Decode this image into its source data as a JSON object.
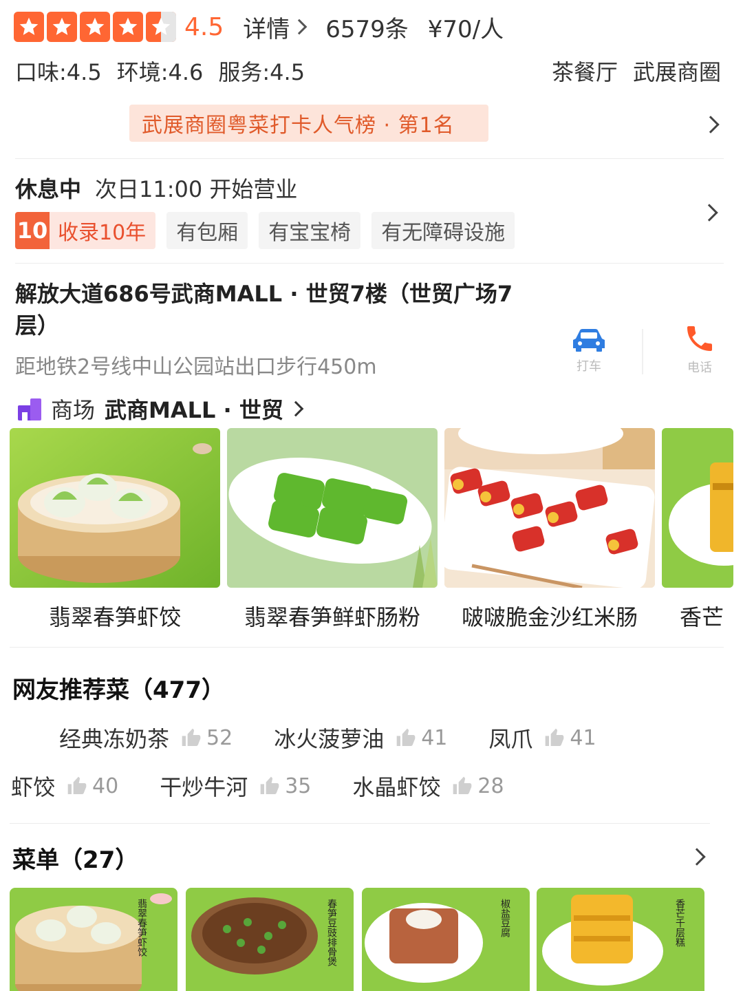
{
  "rating": {
    "score": "4.5",
    "detail_label": "详情",
    "review_count": "6579条",
    "price": "¥70/人"
  },
  "sub_scores": [
    "口味:4.5",
    "环境:4.6",
    "服务:4.5"
  ],
  "categories": [
    "茶餐厅",
    "武展商圈"
  ],
  "rank_banner": "武展商圈粤菜打卡人气榜 · 第1名",
  "status": {
    "state": "休息中",
    "next_open": "次日11:00 开始营业"
  },
  "tags": {
    "years_badge": "10",
    "years_label": "收录10年",
    "items": [
      "有包厢",
      "有宝宝椅",
      "有无障碍设施"
    ]
  },
  "address": {
    "line": "解放大道686号武商MALL · 世贸7楼（世贸广场7层）",
    "metro": "距地铁2号线中山公园站出口步行450m",
    "car_label": "打车",
    "phone_label": "电话"
  },
  "mall": {
    "kind": "商场",
    "name": "武商MALL · 世贸"
  },
  "featured_dishes": [
    {
      "name": "翡翠春笋虾饺"
    },
    {
      "name": "翡翠春笋鲜虾肠粉"
    },
    {
      "name": "啵啵脆金沙红米肠"
    },
    {
      "name": "香芒"
    }
  ],
  "recommended": {
    "title": "网友推荐菜（477）",
    "items": [
      {
        "name": "经典冻奶茶",
        "count": "52"
      },
      {
        "name": "冰火菠萝油",
        "count": "41"
      },
      {
        "name": "凤爪",
        "count": "41"
      },
      {
        "name": "虾饺",
        "count": "40"
      },
      {
        "name": "干炒牛河",
        "count": "35"
      },
      {
        "name": "水晶虾饺",
        "count": "28"
      }
    ]
  },
  "menu": {
    "title": "菜单（27）",
    "cards": [
      {
        "caption": "翡翠春笋虾饺"
      },
      {
        "caption": "春笋豆豉排骨煲"
      },
      {
        "caption": "椒盐豆腐"
      },
      {
        "caption": "香芒千层糕"
      }
    ]
  },
  "colors": {
    "accent": "#ff6633",
    "dish_bg_green": "#8cc63f",
    "mall_purple": "#7b3fe4"
  }
}
